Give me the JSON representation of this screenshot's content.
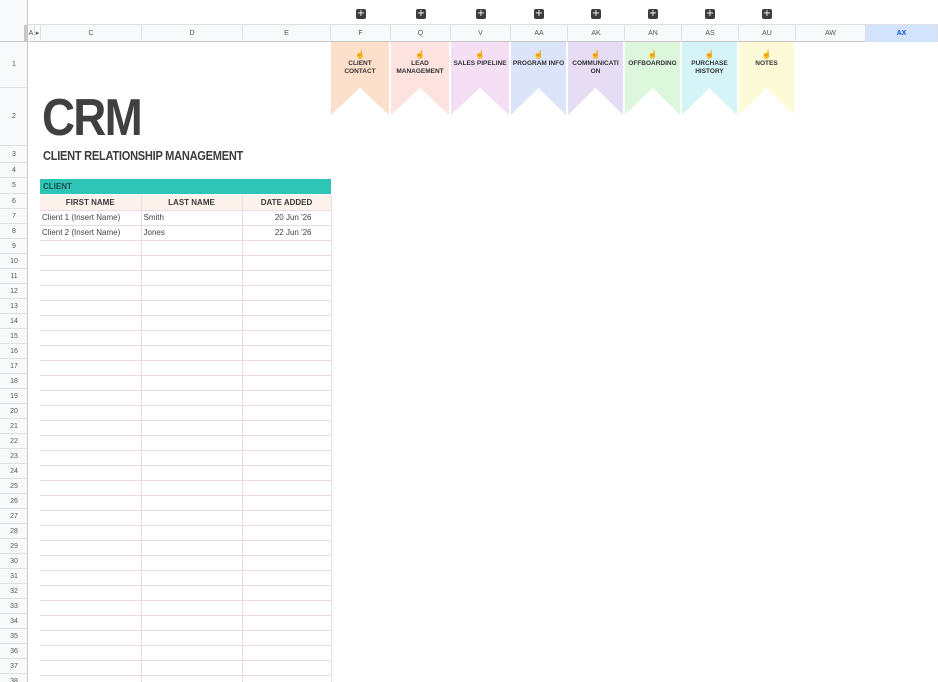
{
  "group_bar": {
    "expand_symbol": "+",
    "expand_count": 8
  },
  "columns": [
    {
      "label": "A"
    },
    {
      "label": "▸"
    },
    {
      "label": "C"
    },
    {
      "label": "D"
    },
    {
      "label": "E"
    },
    {
      "label": "F"
    },
    {
      "label": "Q"
    },
    {
      "label": "V"
    },
    {
      "label": "AA"
    },
    {
      "label": "AK"
    },
    {
      "label": "AN"
    },
    {
      "label": "AS"
    },
    {
      "label": "AU"
    },
    {
      "label": "AW"
    },
    {
      "label": "AX",
      "selected": true
    }
  ],
  "rows": [
    "1",
    "2",
    "3",
    "4",
    "5",
    "6",
    "7",
    "8",
    "9",
    "10",
    "11",
    "12",
    "13",
    "14",
    "15",
    "16",
    "17",
    "18",
    "19",
    "20",
    "21",
    "22",
    "23",
    "24",
    "25",
    "26",
    "27",
    "28",
    "29",
    "30",
    "31",
    "32",
    "33",
    "34",
    "35",
    "36",
    "37",
    "38"
  ],
  "banners": [
    {
      "label": "CLIENT CONTACT",
      "color": "#fde0cc",
      "icon": "pointing-hand-icon"
    },
    {
      "label": "LEAD MANAGEMENT",
      "color": "#fde3e0",
      "icon": "pointing-hand-icon"
    },
    {
      "label": "SALES PIPELINE",
      "color": "#f5dff5",
      "icon": "pointing-hand-icon"
    },
    {
      "label": "PROGRAM INFO",
      "color": "#dbe4f8",
      "icon": "pointing-hand-icon"
    },
    {
      "label": "COMMUNICATI ON",
      "color": "#e6ddf5",
      "icon": "pointing-hand-icon"
    },
    {
      "label": "OFFBOARDING",
      "color": "#dcf7dc",
      "icon": "pointing-hand-icon"
    },
    {
      "label": "PURCHASE HISTORY",
      "color": "#d4f4f7",
      "icon": "pointing-hand-icon"
    },
    {
      "label": "NOTES",
      "color": "#fdfad8",
      "icon": "pointing-hand-icon"
    }
  ],
  "title": "CRM",
  "subtitle": "CLIENT RELATIONSHIP MANAGEMENT",
  "client_table": {
    "section_label": "CLIENT",
    "section_color": "#2ec4b6",
    "headers": [
      "FIRST NAME",
      "LAST NAME",
      "DATE ADDED"
    ],
    "rows": [
      [
        "Client 1 (Insert Name)",
        "Smith",
        "20 Jun '26"
      ],
      [
        "Client 2 (Insert Name)",
        "Jones",
        "22 Jun '26"
      ]
    ],
    "empty_rows": 30
  },
  "colors": {
    "header_bg": "#fdf2ec",
    "grid_line": "#f1d9e4",
    "selected_col": "#d3e3fd"
  }
}
